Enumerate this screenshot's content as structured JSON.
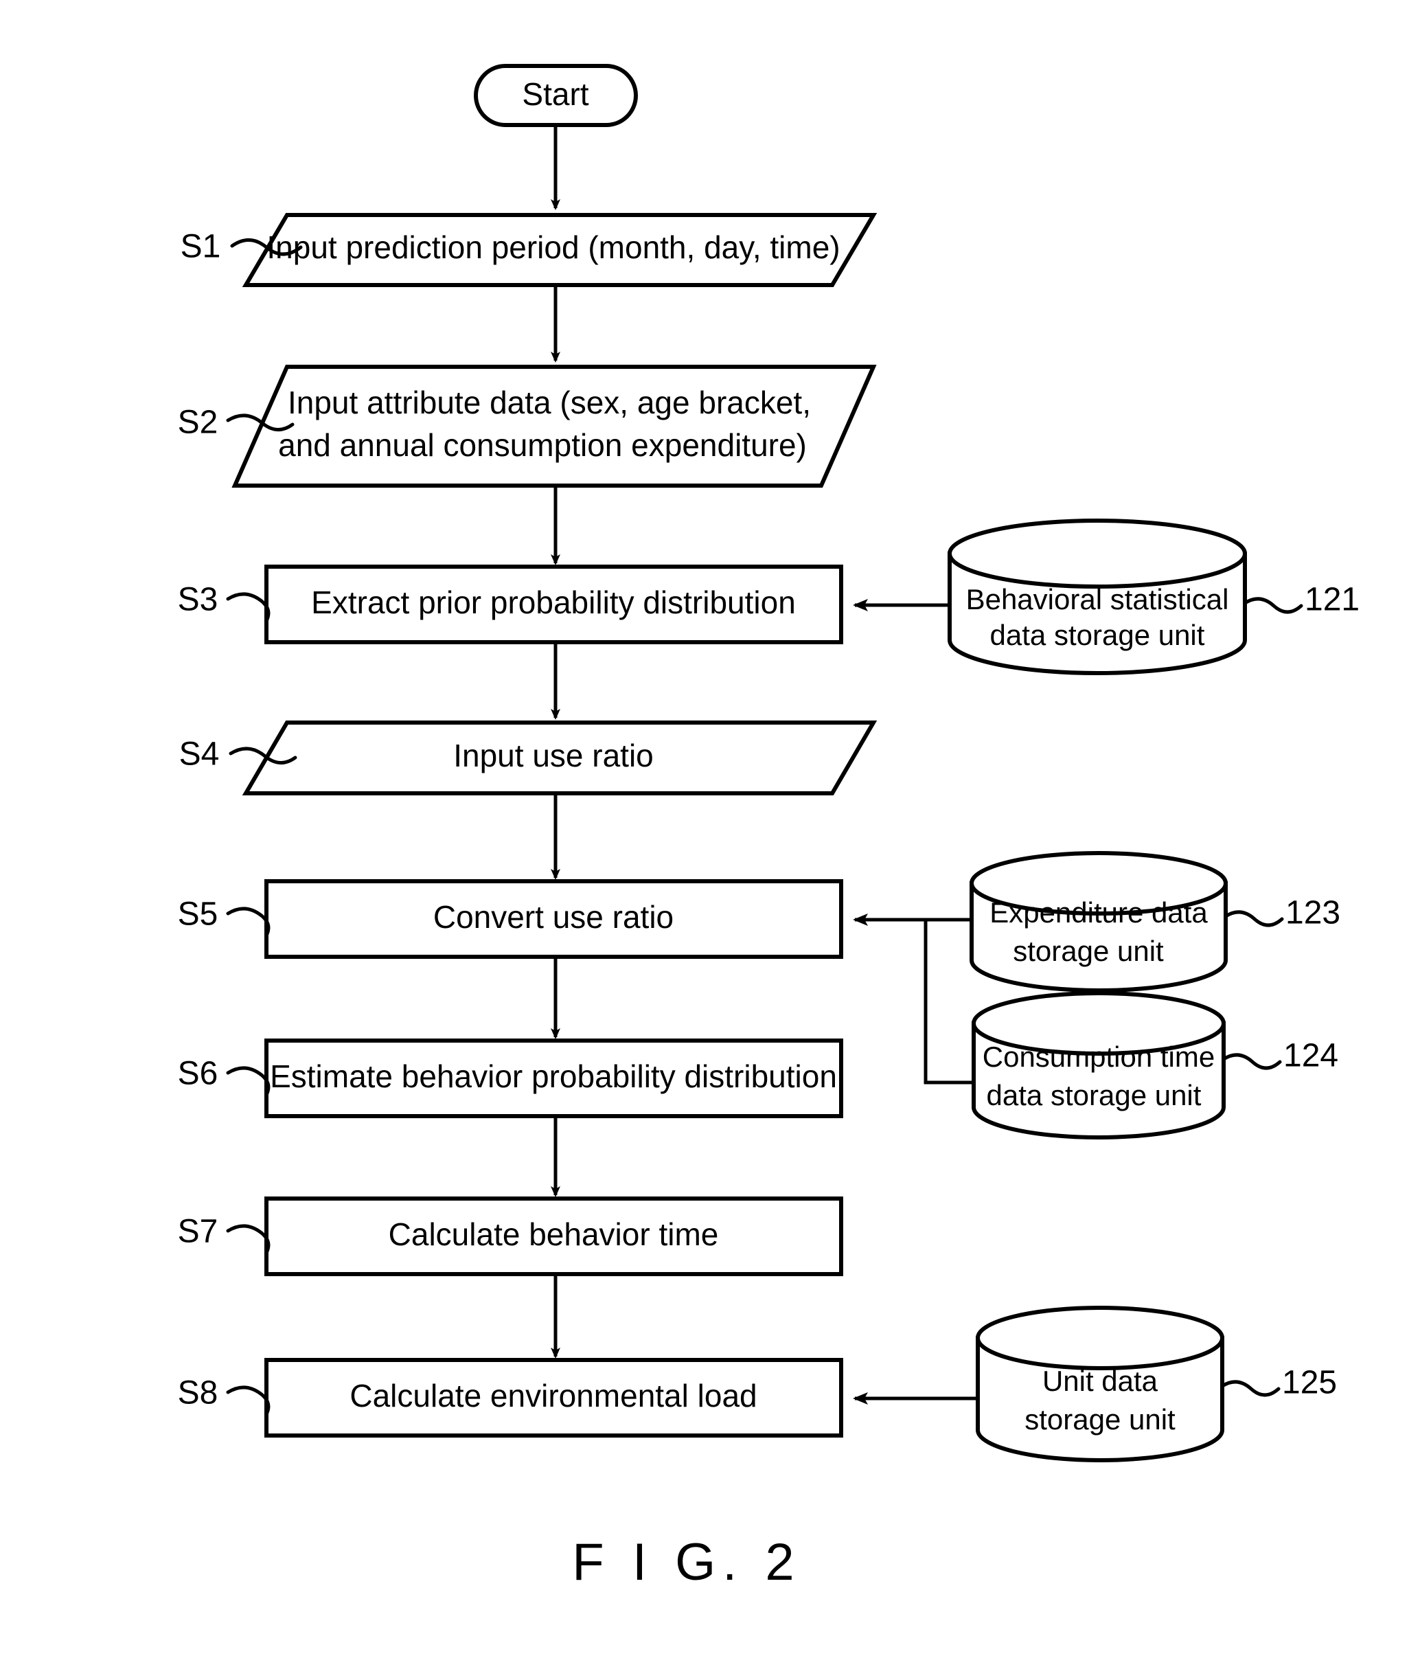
{
  "figure": {
    "caption": "F I G. 2"
  },
  "flowchart": {
    "terminator": {
      "label": "Start"
    },
    "steps": [
      {
        "id": "S1",
        "step_label": "S1",
        "shape": "parallelogram",
        "lines": [
          "Input prediction period (month, day, time)"
        ]
      },
      {
        "id": "S2",
        "step_label": "S2",
        "shape": "parallelogram",
        "lines": [
          "Input attribute data (sex, age bracket,",
          "and annual consumption expenditure)"
        ]
      },
      {
        "id": "S3",
        "step_label": "S3",
        "shape": "process",
        "lines": [
          "Extract prior probability distribution"
        ]
      },
      {
        "id": "S4",
        "step_label": "S4",
        "shape": "parallelogram",
        "lines": [
          "Input use ratio"
        ]
      },
      {
        "id": "S5",
        "step_label": "S5",
        "shape": "process",
        "lines": [
          "Convert use ratio"
        ]
      },
      {
        "id": "S6",
        "step_label": "S6",
        "shape": "process",
        "lines": [
          "Estimate behavior probability distribution"
        ]
      },
      {
        "id": "S7",
        "step_label": "S7",
        "shape": "process",
        "lines": [
          "Calculate behavior time"
        ]
      },
      {
        "id": "S8",
        "step_label": "S8",
        "shape": "process",
        "lines": [
          "Calculate environmental load"
        ]
      }
    ],
    "data_stores": [
      {
        "ref": "121",
        "shape": "cylinder",
        "lines": [
          "Behavioral statistical",
          "data storage unit"
        ],
        "feeds_step": "S3"
      },
      {
        "ref": "123",
        "shape": "cylinder",
        "lines": [
          "Expenditure data",
          "storage unit"
        ],
        "feeds_step": "S5"
      },
      {
        "ref": "124",
        "shape": "cylinder",
        "lines": [
          "Consumption time",
          "data storage unit"
        ],
        "feeds_step": "S5"
      },
      {
        "ref": "125",
        "shape": "cylinder",
        "lines": [
          "Unit data",
          "storage unit"
        ],
        "feeds_step": "S8"
      }
    ]
  },
  "colors": {
    "ink": "#000000",
    "paper": "#ffffff"
  }
}
